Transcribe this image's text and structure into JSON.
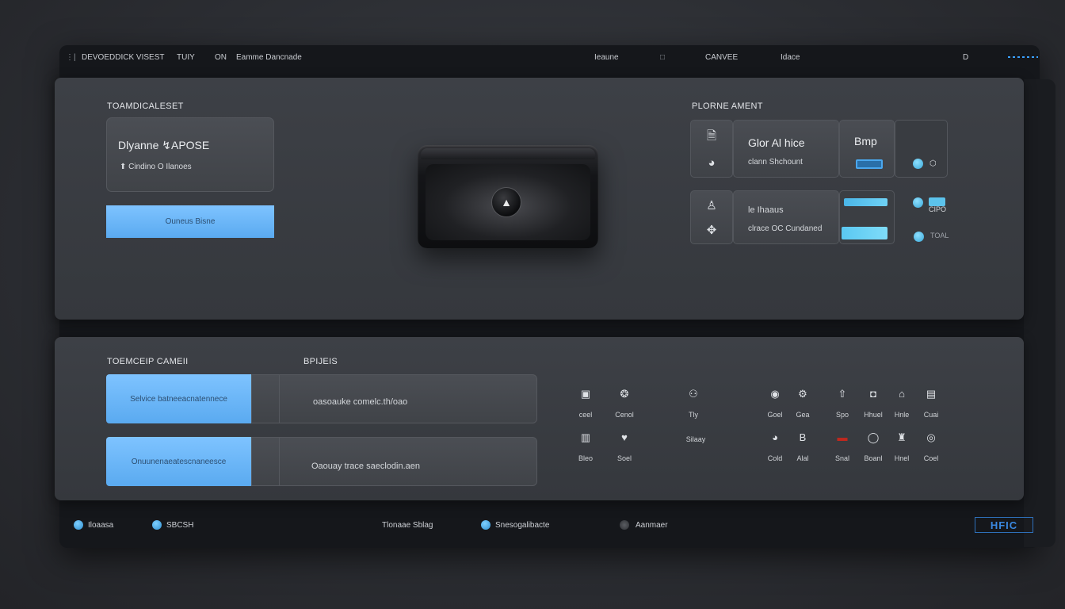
{
  "topbar": {
    "items": [
      "DEVOEDDICK VISEST",
      "TUIY",
      "ON",
      "Eamme Dancnade"
    ],
    "right": [
      "Ieaune",
      "□",
      "CANVEE",
      "Idace",
      "D"
    ]
  },
  "target_panel": {
    "title": "TOAMDICALESET",
    "card_title": "Dlyanne ↯APOSE",
    "card_sub": "⬆ Cindino O Ilanoes",
    "button": "Ouneus Bisne"
  },
  "device": {
    "knob_icon": "▲"
  },
  "profile": {
    "title": "PLORNE AMENT",
    "row1": {
      "icon_top": "🗎",
      "icon_bottom": "◕",
      "title": "Glor Al hice",
      "sub": "clann Shchount",
      "badge_title": "Bmp",
      "side_label": "⬡"
    },
    "row2": {
      "icon_top": "♙",
      "icon_bottom": "✥",
      "title": "le Ihaaus",
      "sub": "clrace OC Cundaned",
      "side_label1": "CIPO",
      "side_label2": "TOAL"
    }
  },
  "lower": {
    "title": "TOEMCEIP CAMEII",
    "col2": "BPIJEIS",
    "rows": [
      {
        "button": "Selvice batneeacnatennece",
        "text": "oasoauke comelc.th/oao"
      },
      {
        "button": "Onuunenaeatescnaneesce",
        "text": "Oaouay trace saeclodin.aen"
      }
    ]
  },
  "grid": {
    "icons": [
      {
        "name": "box-icon",
        "glyph": "▣",
        "label": "ceel"
      },
      {
        "name": "brain-icon",
        "glyph": "❂",
        "label": "Cenol"
      },
      {
        "name": "brain-alt-icon",
        "glyph": "⚇",
        "label": "Tly"
      },
      {
        "name": "ring-icon",
        "glyph": "◉",
        "label": "Goel"
      },
      {
        "name": "gear-icon",
        "glyph": "⚙",
        "label": "Gea"
      },
      {
        "name": "arrow-up-icon",
        "glyph": "⇧",
        "label": "Spo"
      },
      {
        "name": "camera-icon",
        "glyph": "◘",
        "label": "Hhuel"
      },
      {
        "name": "home-icon",
        "glyph": "⌂",
        "label": "Hnle"
      },
      {
        "name": "box-alt-icon",
        "glyph": "▤",
        "label": "Cuai"
      },
      {
        "name": "chart-icon",
        "glyph": "▥",
        "label": "Bleo"
      },
      {
        "name": "heart-icon",
        "glyph": "♥",
        "label": "Soel"
      },
      {
        "name": "sleep-icon",
        "glyph": "",
        "label": "Silaay"
      },
      {
        "name": "bag-icon",
        "glyph": "◕",
        "label": "Cold"
      },
      {
        "name": "b-icon",
        "glyph": "B",
        "label": "Alal"
      },
      {
        "name": "flag-icon",
        "glyph": "▬",
        "label": "Snal"
      },
      {
        "name": "donut-icon",
        "glyph": "◯",
        "label": "Boanl"
      },
      {
        "name": "trash-icon",
        "glyph": "♜",
        "label": "Hnel"
      },
      {
        "name": "camera-alt-icon",
        "glyph": "◎",
        "label": "Coel"
      }
    ]
  },
  "footer": {
    "items": [
      "Iloaasa",
      "SBCSH",
      "Tlonaae Sblag",
      "Snesogalibacte",
      "Aanmaer"
    ],
    "brand": "HFIC"
  },
  "colors": {
    "accent": "#5aaaf0",
    "cyan": "#4ab6e8",
    "panel": "#3a3d43",
    "window": "#15171b"
  }
}
